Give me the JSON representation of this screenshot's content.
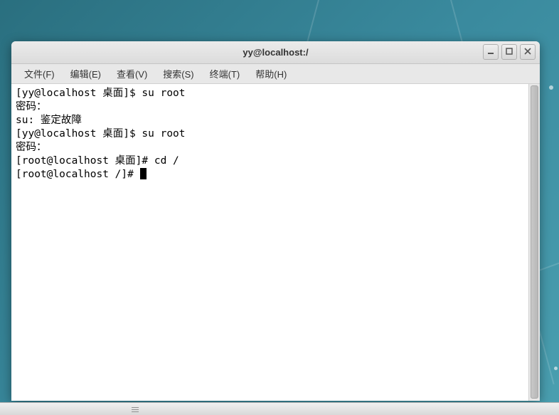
{
  "window": {
    "title": "yy@localhost:/"
  },
  "menu": {
    "file": "文件(F)",
    "edit": "编辑(E)",
    "view": "查看(V)",
    "search": "搜索(S)",
    "terminal": "终端(T)",
    "help": "帮助(H)"
  },
  "terminal_lines": [
    "[yy@localhost 桌面]$ su root",
    "密码：",
    "su: 鉴定故障",
    "[yy@localhost 桌面]$ su root",
    "密码：",
    "[root@localhost 桌面]# cd /",
    "[root@localhost /]# "
  ]
}
